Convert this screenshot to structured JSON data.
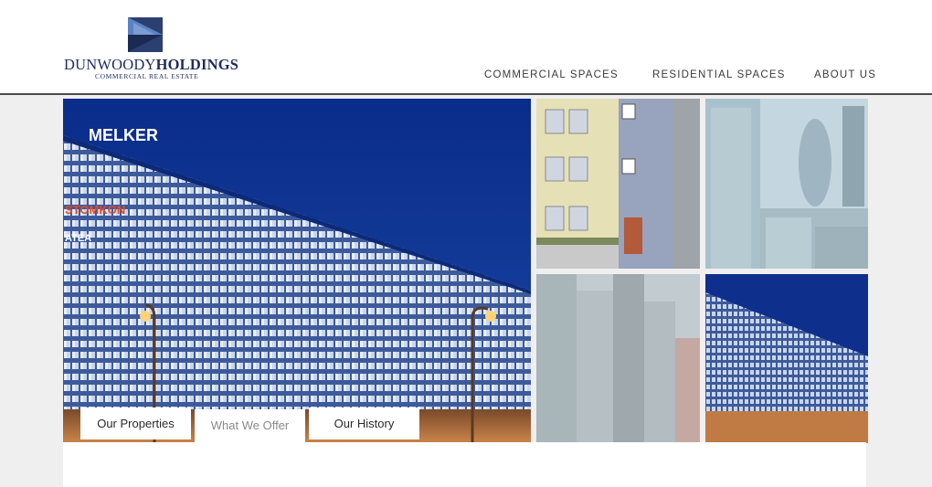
{
  "brand": {
    "name_part1": "DUNWOODY",
    "name_part2": "HOLDINGS",
    "tagline": "COMMERCIAL REAL ESTATE",
    "colors": {
      "navy": "#1f2d5a",
      "blue": "#2f5fa6"
    }
  },
  "nav": {
    "items": [
      {
        "label": "COMMERCIAL SPACES"
      },
      {
        "label": "RESIDENTIAL SPACES"
      },
      {
        "label": "ABOUT US"
      }
    ]
  },
  "hero": {
    "signs": [
      "MELKER",
      "STOMKON",
      "ATEA"
    ]
  },
  "tabs": {
    "items": [
      {
        "label": "Our Properties"
      },
      {
        "label": "What We Offer"
      },
      {
        "label": "Our History"
      }
    ],
    "active_index": 1
  },
  "gallery": {
    "thumbs": [
      "residential-building",
      "city-skyline",
      "skyscrapers",
      "office-building-night"
    ]
  }
}
